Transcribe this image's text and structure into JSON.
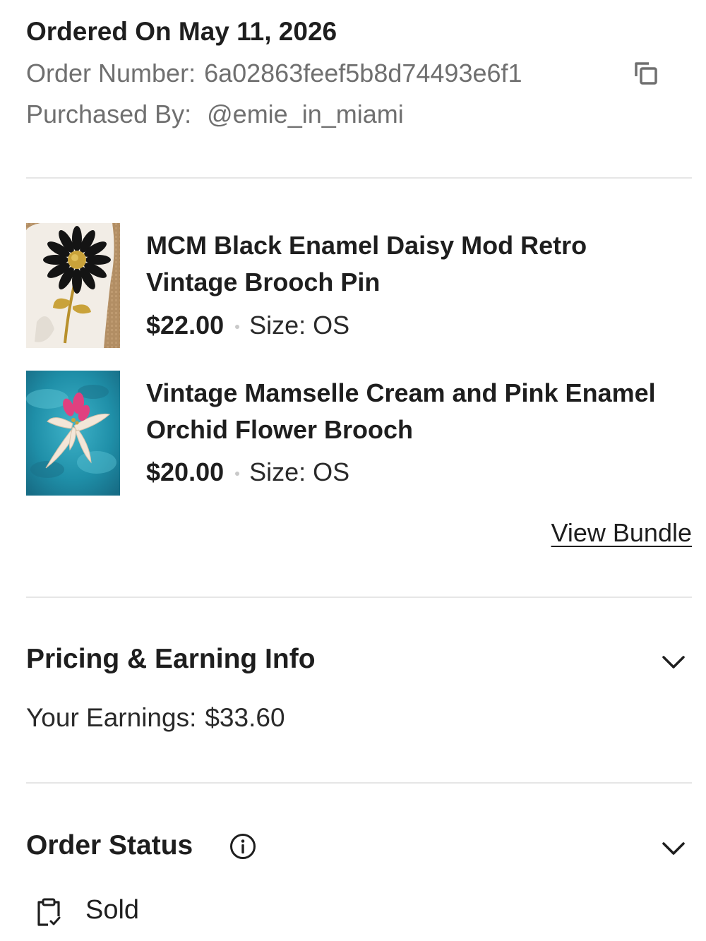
{
  "header": {
    "order_title": "Ordered On May 11, 2026",
    "order_number_label": "Order Number:",
    "order_number": "6a02863feef5b8d74493e6f1",
    "purchased_by_label": "Purchased By:",
    "purchased_by": "@emie_in_miami",
    "copy_icon": "copy-icon"
  },
  "items": [
    {
      "title": "MCM Black Enamel Daisy Mod Retro Vintage Brooch Pin",
      "price": "$22.00",
      "size_label": "Size:",
      "size_value": "OS"
    },
    {
      "title": "Vintage Mamselle Cream and Pink Enamel Orchid Flower Brooch",
      "price": "$20.00",
      "size_label": "Size:",
      "size_value": "OS"
    }
  ],
  "view_bundle_label": "View Bundle",
  "pricing": {
    "title": "Pricing & Earning Info",
    "earnings_label": "Your Earnings:",
    "earnings_value": "$33.60",
    "toggle_icon": "chevron-down-icon"
  },
  "order_status": {
    "title": "Order Status",
    "info_icon": "info-icon",
    "toggle_icon": "chevron-down-icon",
    "status_icon": "clipboard-check-icon",
    "status": "Sold"
  },
  "colors": {
    "text_primary": "#1e1e1e",
    "text_secondary": "#6f6f6f",
    "divider": "#e6e6e6"
  }
}
